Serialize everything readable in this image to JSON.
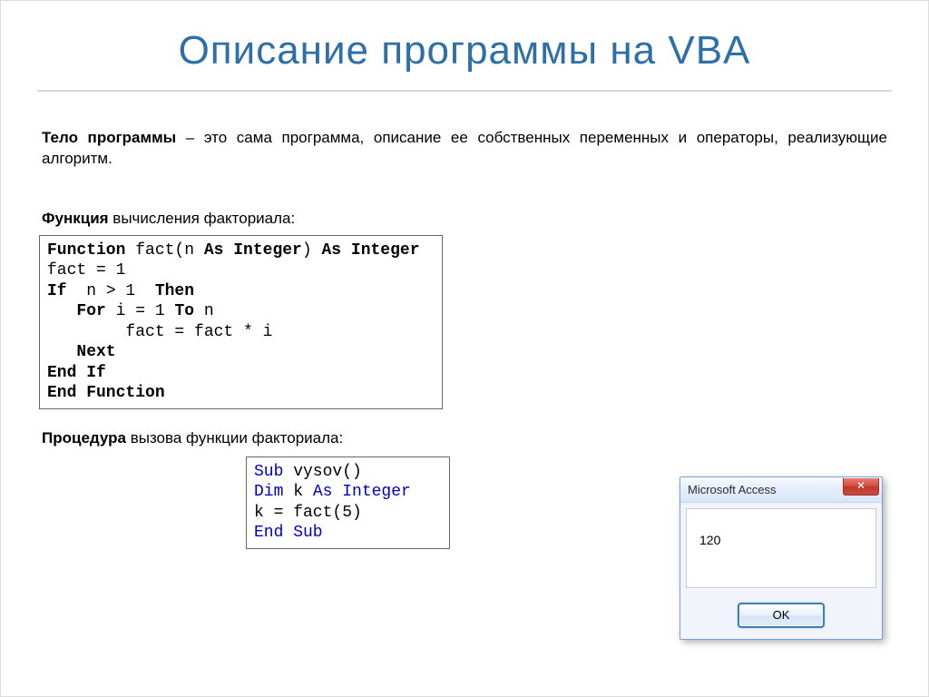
{
  "title": "Описание программы на VBA",
  "intro": {
    "bold": "Тело программы",
    "rest": " – это сама программа, описание ее собственных переменных и операторы, реализующие алгоритм."
  },
  "sub1": {
    "bold": "Функция",
    "rest": " вычисления факториала:"
  },
  "code1": {
    "l1": {
      "kw1": "Function",
      "mid": " fact(n ",
      "kw2": "As Integer",
      "mid2": ") ",
      "kw3": "As Integer"
    },
    "l2": "fact = 1",
    "l3": {
      "kw1": "If",
      "mid": "  n > 1  ",
      "kw2": "Then"
    },
    "l4": {
      "pad": "   ",
      "kw1": "For",
      "mid": " i = 1 ",
      "kw2": "To",
      "end": " n"
    },
    "l5": "        fact = fact * i",
    "l6": {
      "pad": "   ",
      "kw1": "Next"
    },
    "l7": {
      "kw1": "End If"
    },
    "l8": {
      "kw1": "End Function"
    }
  },
  "sub2": {
    "bold": "Процедура",
    "rest": " вызова функции факториала:"
  },
  "code2": {
    "l1": {
      "kw1": "Sub",
      "mid": " vysov()"
    },
    "l2": {
      "kw1": "Dim",
      "mid": " k ",
      "kw2": "As Integer"
    },
    "l3": "k = fact(5)",
    "l4": {
      "kw1": "End Sub"
    }
  },
  "msgbox": {
    "title": "Microsoft Access",
    "close_glyph": "✕",
    "value": "120",
    "ok": "OK"
  }
}
